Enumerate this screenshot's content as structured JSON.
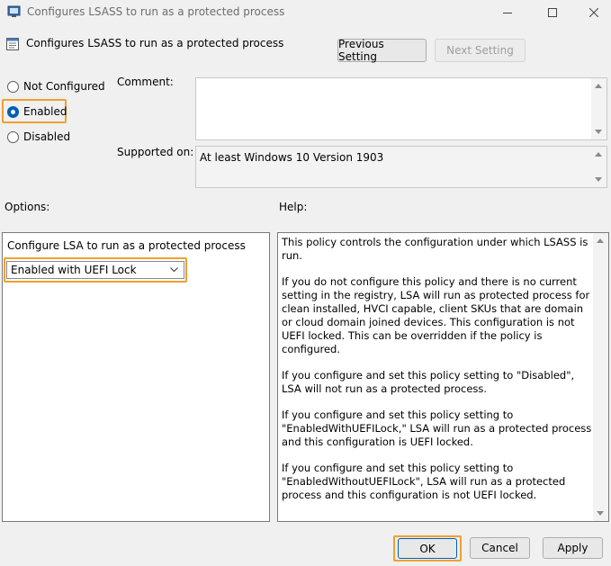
{
  "window": {
    "title": "Configures LSASS to run as a protected process",
    "icons": {
      "app": "gpo-editor-icon",
      "minimize": "minimize-icon",
      "maximize": "maximize-icon",
      "close": "close-icon"
    }
  },
  "header": {
    "policy_name": "Configures LSASS to run as a protected process",
    "previous_label": "Previous Setting",
    "next_label": "Next Setting"
  },
  "state": {
    "options": [
      {
        "label": "Not Configured",
        "checked": false
      },
      {
        "label": "Enabled",
        "checked": true
      },
      {
        "label": "Disabled",
        "checked": false
      }
    ]
  },
  "comment": {
    "label": "Comment:",
    "value": ""
  },
  "supported": {
    "label": "Supported on:",
    "value": "At least Windows 10 Version 1903"
  },
  "options_panel": {
    "label": "Options:",
    "setting_label": "Configure LSA to run as a protected process",
    "dropdown_value": "Enabled with UEFI Lock"
  },
  "help_panel": {
    "label": "Help:",
    "paragraphs": [
      "This policy controls the configuration under which LSASS is run.",
      "If you do not configure this policy and there is no current setting in the registry, LSA will run as protected process for clean installed, HVCI capable, client SKUs that are domain or cloud domain joined devices. This configuration is not UEFI locked. This can be overridden if the policy is configured.",
      "If you configure and set this policy setting to \"Disabled\", LSA will not run as a protected process.",
      "If you configure and set this policy setting to \"EnabledWithUEFILock,\" LSA will run as a protected process and this configuration is UEFI locked.",
      "If you configure and set this policy setting to \"EnabledWithoutUEFILock\", LSA will run as a protected process and this configuration is not UEFI locked."
    ]
  },
  "footer": {
    "ok_label": "OK",
    "cancel_label": "Cancel",
    "apply_label": "Apply"
  },
  "colors": {
    "accent": "#005fb8",
    "highlight": "#f0a030"
  }
}
